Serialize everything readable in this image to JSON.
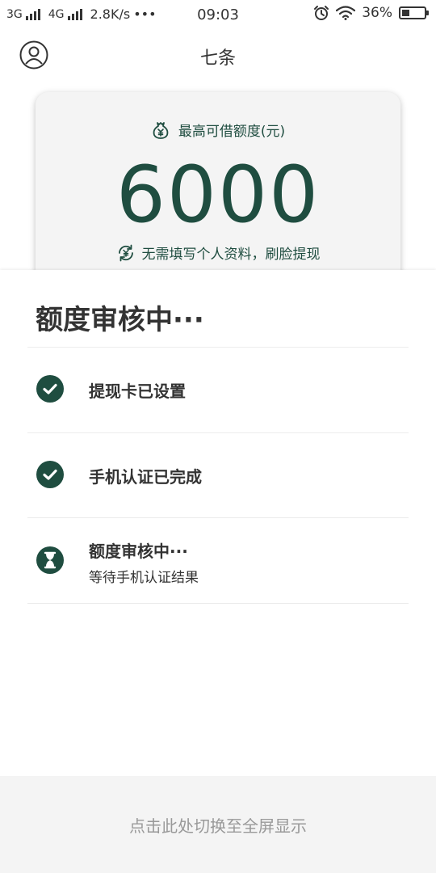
{
  "status_bar": {
    "network_1": "3G",
    "network_2": "4G",
    "speed": "2.8K/s",
    "more": "•••",
    "time": "09:03",
    "battery_percent": "36%",
    "battery_level": 0.36
  },
  "header": {
    "title": "七条"
  },
  "quota_card": {
    "label": "最高可借额度(元)",
    "amount": "6000",
    "note": "无需填写个人资料，刷脸提现"
  },
  "review": {
    "title": "额度审核中···",
    "steps": [
      {
        "title": "提现卡已设置",
        "status": "done",
        "icon": "check-circle-icon"
      },
      {
        "title": "手机认证已完成",
        "status": "done",
        "icon": "check-circle-icon"
      },
      {
        "title": "额度审核中···",
        "subtitle": "等待手机认证结果",
        "status": "pending",
        "icon": "hourglass-icon"
      }
    ]
  },
  "fullscreen": {
    "label": "点击此处切换至全屏显示"
  },
  "colors": {
    "accent": "#1f4d40",
    "background": "#ffffff",
    "card_bg": "#f4f4f4",
    "muted_text": "#999999"
  }
}
